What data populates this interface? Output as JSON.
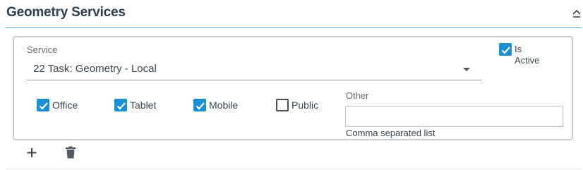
{
  "section": {
    "title": "Geometry Services",
    "toggle_icon": "chevron-up-icon"
  },
  "service": {
    "label": "Service",
    "selected": "22 Task: Geometry - Local"
  },
  "is_active": {
    "label_line1": "Is",
    "label_line2": "Active",
    "checked": true
  },
  "platforms": [
    {
      "label": "Office",
      "checked": true
    },
    {
      "label": "Tablet",
      "checked": true
    },
    {
      "label": "Mobile",
      "checked": true
    },
    {
      "label": "Public",
      "checked": false
    }
  ],
  "other": {
    "label": "Other",
    "value": "",
    "hint": "Comma separated list"
  },
  "actions": {
    "add_icon": "plus-icon",
    "delete_icon": "trash-icon"
  },
  "colors": {
    "accent": "#1b8fd6",
    "header_rule": "#4aa3df",
    "card_border": "#c7cdd3"
  }
}
